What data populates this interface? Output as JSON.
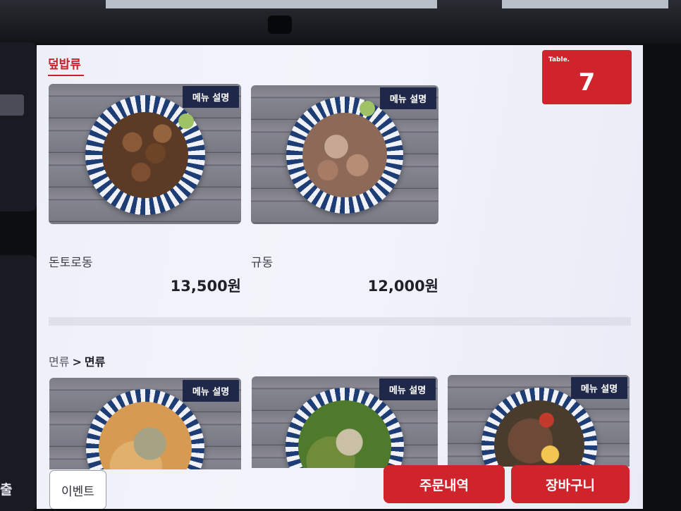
{
  "category": {
    "title": "덮밥류"
  },
  "table": {
    "label": "Table.",
    "number": "7"
  },
  "sections": [
    {
      "items": [
        {
          "name": "돈토로동",
          "price": "13,500원",
          "info_label": "메뉴 설명"
        },
        {
          "name": "규동",
          "price": "12,000원",
          "info_label": "메뉴 설명"
        }
      ]
    },
    {
      "breadcrumb": {
        "parent": "면류",
        "separator": ">",
        "current": "면류"
      },
      "items": [
        {
          "info_label": "메뉴 설명"
        },
        {
          "info_label": "메뉴 설명"
        },
        {
          "info_label": "메뉴 설명"
        }
      ]
    }
  ],
  "side": {
    "partial_label": "출"
  },
  "footer": {
    "event_label": "이벤트",
    "order_history_label": "주문내역",
    "cart_label": "장바구니"
  },
  "colors": {
    "accent": "#d0242d",
    "badge": "#1f2848"
  }
}
